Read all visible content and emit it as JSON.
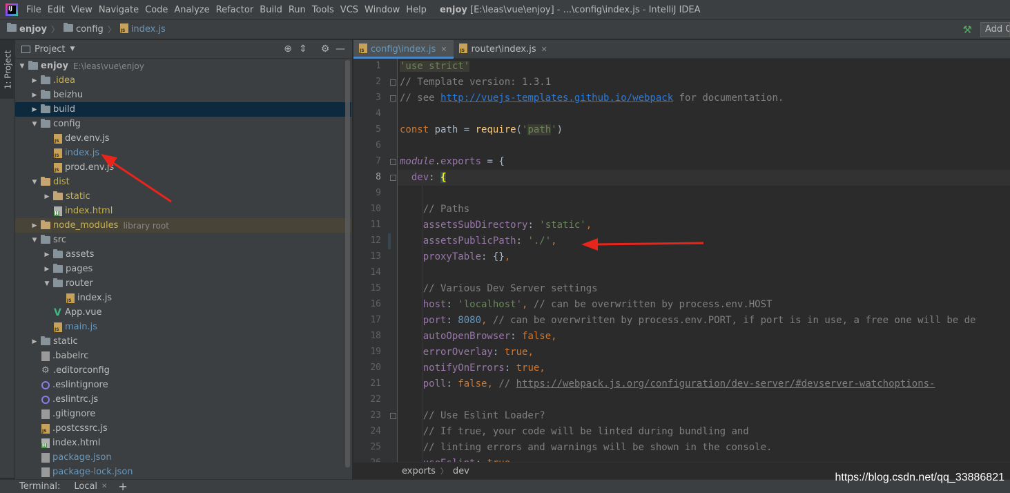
{
  "menubar": {
    "items": [
      "File",
      "Edit",
      "View",
      "Navigate",
      "Code",
      "Analyze",
      "Refactor",
      "Build",
      "Run",
      "Tools",
      "VCS",
      "Window",
      "Help"
    ],
    "title_project": "enjoy",
    "title_rest": "[E:\\leas\\vue\\enjoy] - ...\\config\\index.js - IntelliJ IDEA"
  },
  "navbar": {
    "crumbs": [
      "enjoy",
      "config",
      "index.js"
    ],
    "add_config": "Add C"
  },
  "left_strip": {
    "project_tab": "1: Project"
  },
  "project_panel": {
    "header": "Project",
    "tree": [
      {
        "label": "enjoy",
        "hint": "E:\\leas\\vue\\enjoy"
      },
      {
        "label": ".idea"
      },
      {
        "label": "beizhu"
      },
      {
        "label": "build"
      },
      {
        "label": "config"
      },
      {
        "label": "dev.env.js"
      },
      {
        "label": "index.js"
      },
      {
        "label": "prod.env.js"
      },
      {
        "label": "dist"
      },
      {
        "label": "static"
      },
      {
        "label": "index.html"
      },
      {
        "label": "node_modules",
        "hint": "library root"
      },
      {
        "label": "src"
      },
      {
        "label": "assets"
      },
      {
        "label": "pages"
      },
      {
        "label": "router"
      },
      {
        "label": "index.js"
      },
      {
        "label": "App.vue"
      },
      {
        "label": "main.js"
      },
      {
        "label": "static"
      },
      {
        "label": ".babelrc"
      },
      {
        "label": ".editorconfig"
      },
      {
        "label": ".eslintignore"
      },
      {
        "label": ".eslintrc.js"
      },
      {
        "label": ".gitignore"
      },
      {
        "label": ".postcssrc.js"
      },
      {
        "label": "index.html"
      },
      {
        "label": "package.json"
      },
      {
        "label": "package-lock.json"
      }
    ]
  },
  "editor": {
    "tabs": [
      {
        "label": "config\\index.js",
        "active": true
      },
      {
        "label": "router\\index.js",
        "active": false
      }
    ],
    "current_line": 8,
    "lines": [
      "'use strict'",
      "// Template version: 1.3.1",
      "// see http://vuejs-templates.github.io/webpack for documentation.",
      "",
      "const path = require('path')",
      "",
      "module.exports = {",
      "  dev: {",
      "",
      "    // Paths",
      "    assetsSubDirectory: 'static',",
      "    assetsPublicPath: './',",
      "    proxyTable: {},",
      "",
      "    // Various Dev Server settings",
      "    host: 'localhost', // can be overwritten by process.env.HOST",
      "    port: 8080, // can be overwritten by process.env.PORT, if port is in use, a free one will be de",
      "    autoOpenBrowser: false,",
      "    errorOverlay: true,",
      "    notifyOnErrors: true,",
      "    poll: false, // https://webpack.js.org/configuration/dev-server/#devserver-watchoptions-",
      "",
      "    // Use Eslint Loader?",
      "    // If true, your code will be linted during bundling and",
      "    // linting errors and warnings will be shown in the console.",
      "    useEslint: true,"
    ],
    "breadcrumbs": [
      "exports",
      "dev"
    ]
  },
  "bottombar": {
    "terminal_label": "Terminal:",
    "local_tab": "Local"
  },
  "watermark": "https://blog.csdn.net/qq_33886821",
  "colors": {
    "annotation_arrow": "#e8251b",
    "selection": "#0d293e",
    "accent": "#4a88c7"
  }
}
